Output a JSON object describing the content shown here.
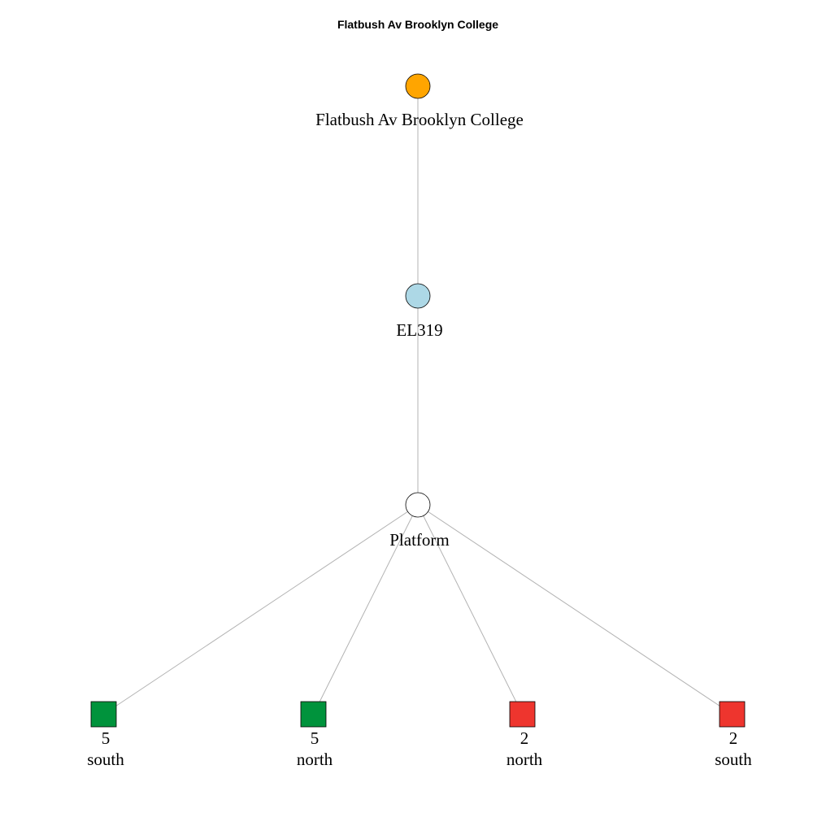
{
  "title": "Flatbush Av Brooklyn College",
  "nodes": {
    "station": {
      "label": "Flatbush Av Brooklyn College",
      "shape": "circle",
      "color": "#FFA500"
    },
    "complex": {
      "label": "EL319",
      "shape": "circle",
      "color": "#ADD8E6"
    },
    "platform": {
      "label": "Platform",
      "shape": "circle",
      "color": "#FFFFFF"
    },
    "routes": [
      {
        "route": "5",
        "direction": "south",
        "shape": "square",
        "color": "#00933C"
      },
      {
        "route": "5",
        "direction": "north",
        "shape": "square",
        "color": "#00933C"
      },
      {
        "route": "2",
        "direction": "north",
        "shape": "square",
        "color": "#EE352E"
      },
      {
        "route": "2",
        "direction": "south",
        "shape": "square",
        "color": "#EE352E"
      }
    ]
  },
  "edges": [
    [
      "station",
      "complex"
    ],
    [
      "complex",
      "platform"
    ],
    [
      "platform",
      "route-0"
    ],
    [
      "platform",
      "route-1"
    ],
    [
      "platform",
      "route-2"
    ],
    [
      "platform",
      "route-3"
    ]
  ]
}
